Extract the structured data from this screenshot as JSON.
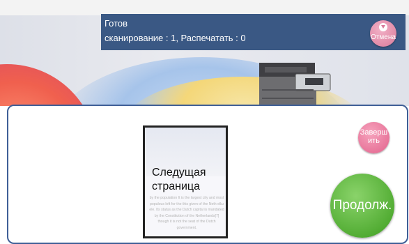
{
  "status": {
    "title": "Готов",
    "counts": "сканирование : 1, Распечатать : 0",
    "cancel_label": "Отмена",
    "cancel_icon": "chevron-down-icon",
    "background_color": "#3a5884"
  },
  "dialog": {
    "border_color": "#3f5f97",
    "preview": {
      "label": "Следущая страница",
      "ghost_text": "by the population It is the largest city and most populous left for the this given of the Neth ellы ele. Its status as the Dutch capital is mandated by the Constitution of the Netherlands[7] though it is not the seat of the Dutch government."
    },
    "finish_button": {
      "label": "Заверш ить",
      "color": "#e2628c"
    },
    "continue_button": {
      "label": "Продолж.",
      "color": "#3c9d1e"
    }
  }
}
